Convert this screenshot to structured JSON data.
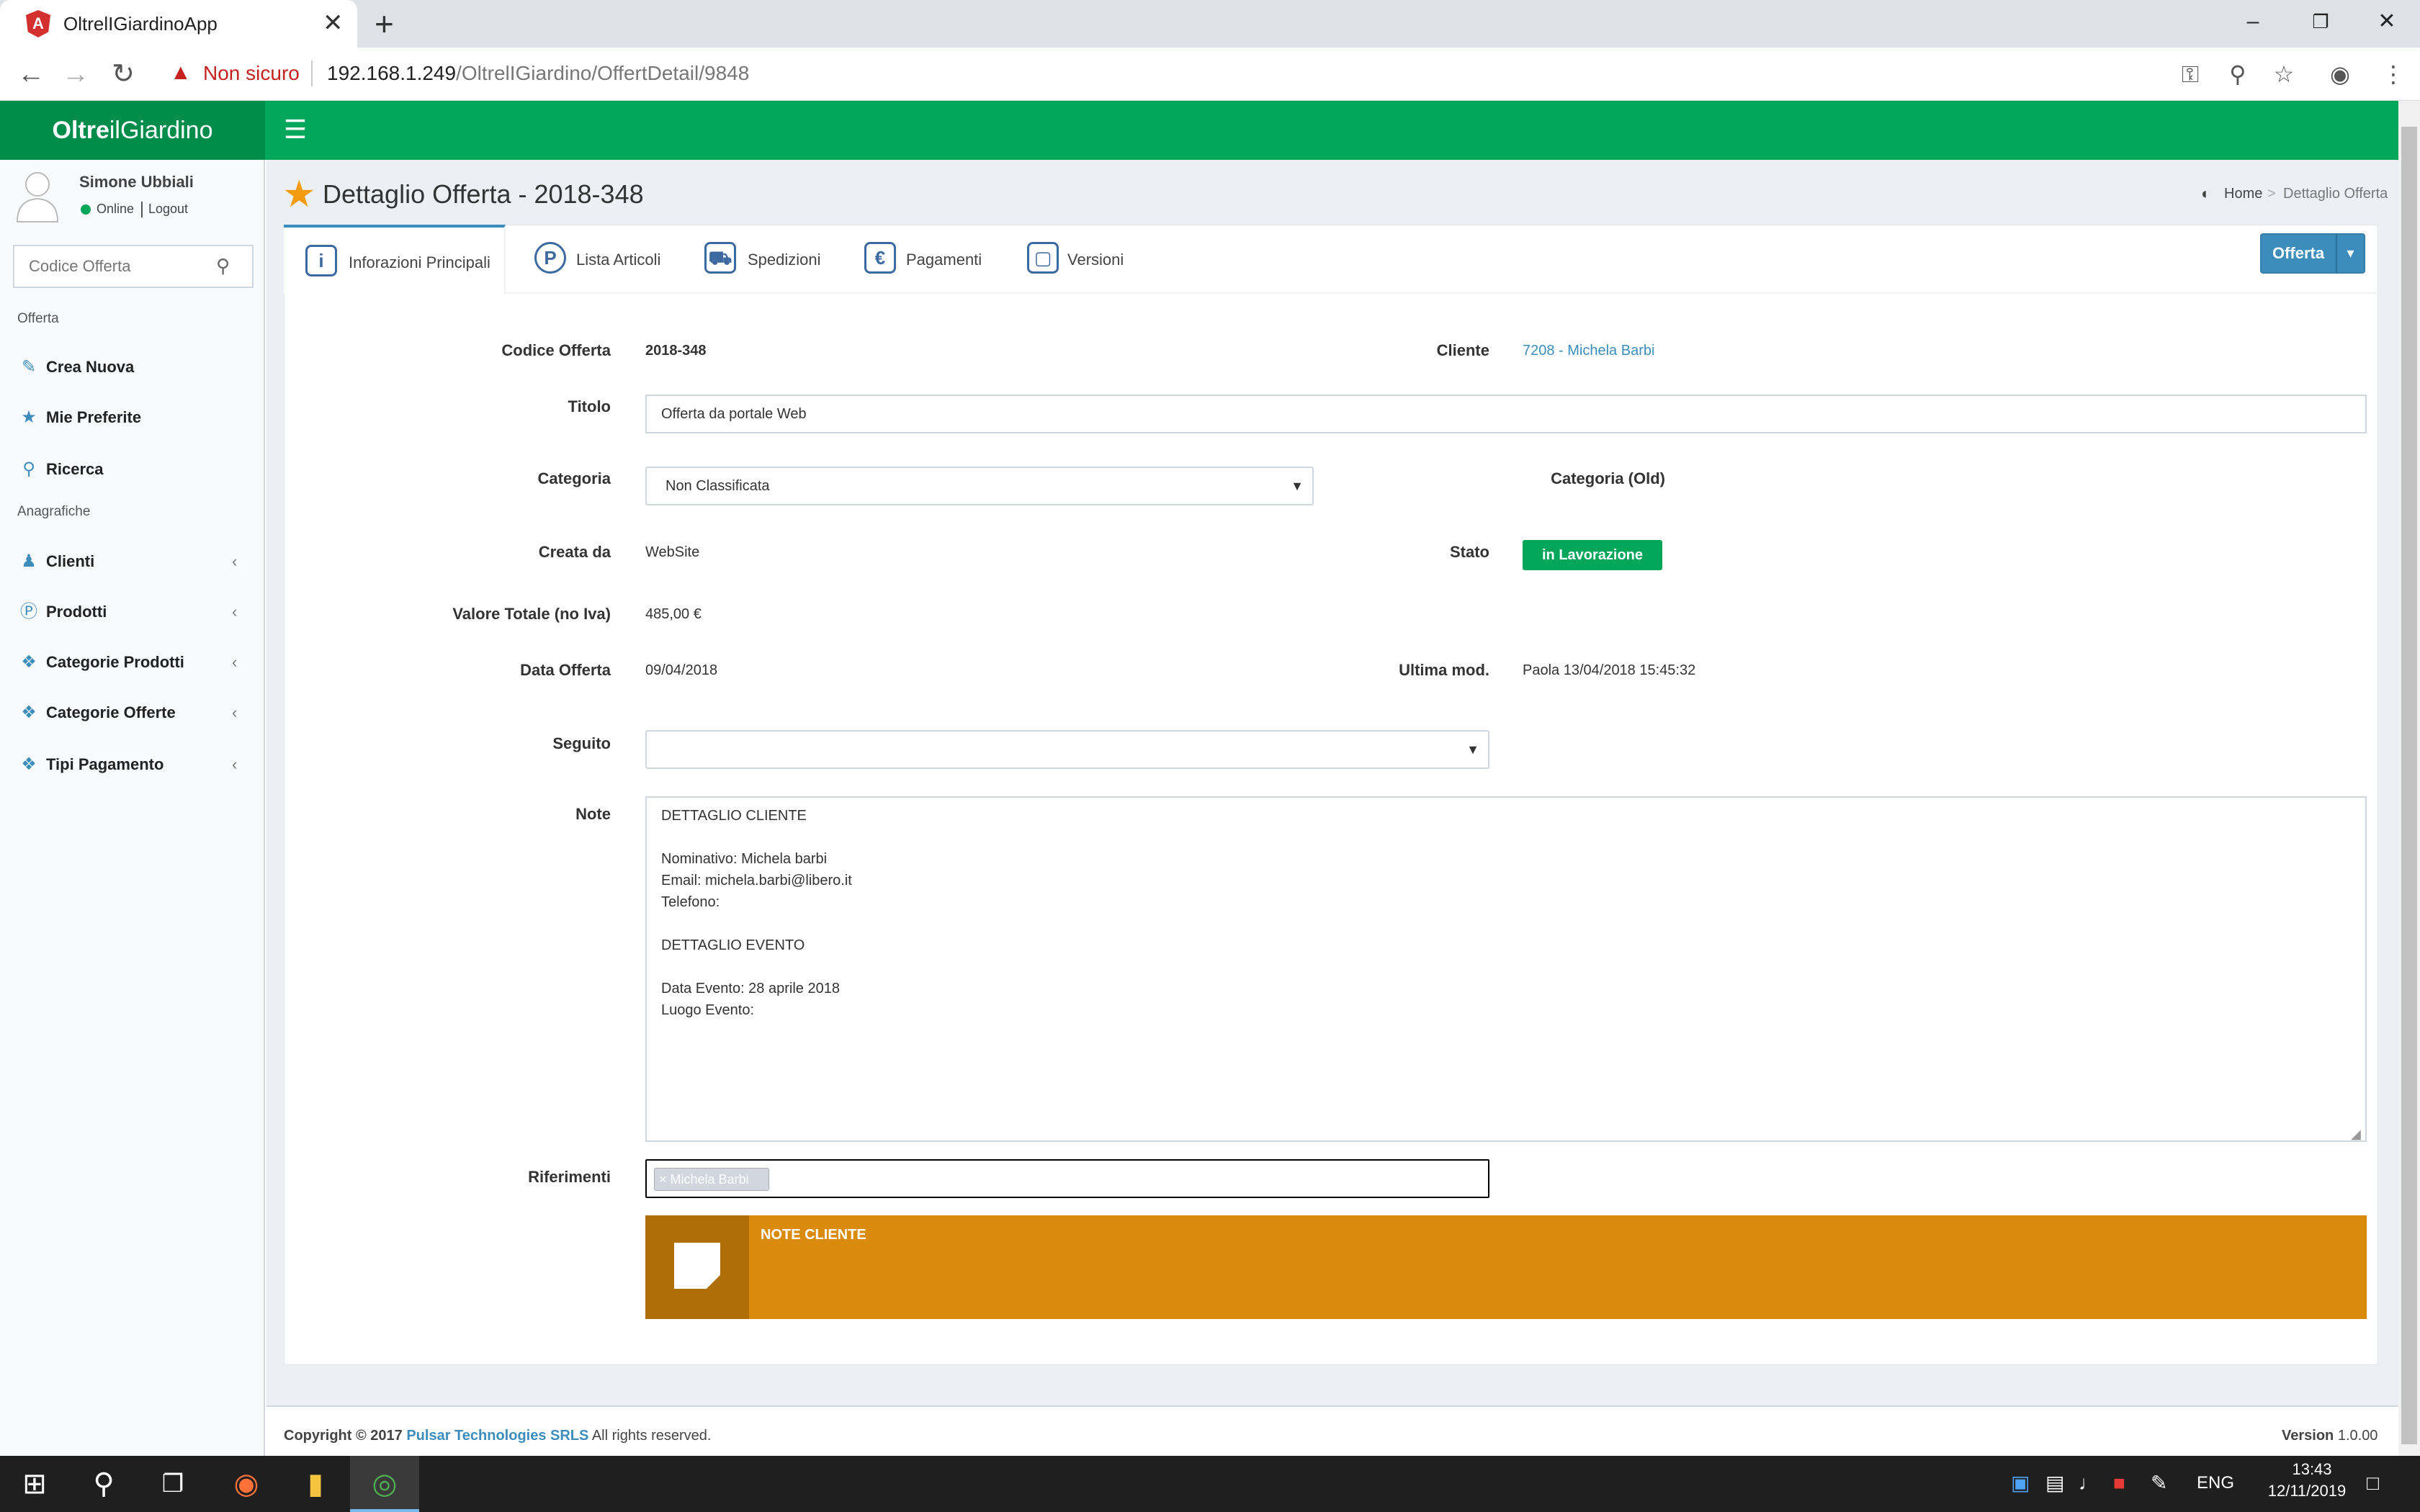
{
  "browser": {
    "tab_title": "OltrelIGiardinoApp",
    "tab_close": "✕",
    "new_tab": "+",
    "security_label": "Non sicuro",
    "url_host": "192.168.1.249",
    "url_path": "/OltrelIGiardino/OffertDetail/9848"
  },
  "app": {
    "logo_bold": "Oltre",
    "logo_rest": "ilGiardino"
  },
  "sidebar": {
    "user_name": "Simone Ubbiali",
    "user_status": "Online",
    "logout": "Logout",
    "search_placeholder": "Codice Offerta",
    "section_offerta": "Offerta",
    "section_anagrafiche": "Anagrafiche",
    "items": [
      {
        "label": "Crea Nuova",
        "icon": "pencil-icon"
      },
      {
        "label": "Mie Preferite",
        "icon": "star-icon"
      },
      {
        "label": "Ricerca",
        "icon": "search-icon"
      },
      {
        "label": "Clienti",
        "icon": "users-icon"
      },
      {
        "label": "Prodotti",
        "icon": "p-circle-icon"
      },
      {
        "label": "Categorie Prodotti",
        "icon": "tags-icon"
      },
      {
        "label": "Categorie Offerte",
        "icon": "tags-icon"
      },
      {
        "label": "Tipi Pagamento",
        "icon": "tags-icon"
      }
    ]
  },
  "page": {
    "title": "Dettaglio Offerta - 2018-348",
    "breadcrumb_home": "Home",
    "breadcrumb_current": "Dettaglio Offerta"
  },
  "tabs": [
    {
      "label": "Inforazioni Principali",
      "icon_glyph": "i"
    },
    {
      "label": "Lista Articoli",
      "icon_glyph": "P"
    },
    {
      "label": "Spedizioni",
      "icon_glyph": "⛟"
    },
    {
      "label": "Pagamenti",
      "icon_glyph": "€"
    },
    {
      "label": "Versioni",
      "icon_glyph": "▢"
    }
  ],
  "action_button": "Offerta",
  "form": {
    "codice_label": "Codice Offerta",
    "codice_value": "2018-348",
    "cliente_label": "Cliente",
    "cliente_value": "7208 - Michela Barbi",
    "titolo_label": "Titolo",
    "titolo_value": "Offerta da portale Web",
    "categoria_label": "Categoria",
    "categoria_value": "Non Classificata",
    "categoria_old_label": "Categoria (Old)",
    "creata_label": "Creata da",
    "creata_value": "WebSite",
    "stato_label": "Stato",
    "stato_value": "in Lavorazione",
    "valore_label": "Valore Totale (no Iva)",
    "valore_value": "485,00 €",
    "data_label": "Data Offerta",
    "data_value": "09/04/2018",
    "ultima_label": "Ultima mod.",
    "ultima_value": "Paola 13/04/2018 15:45:32",
    "seguito_label": "Seguito",
    "seguito_value": "",
    "note_label": "Note",
    "note_lines": [
      "DETTAGLIO CLIENTE",
      "",
      "Nominativo: Michela barbi",
      "Email: michela.barbi@libero.it",
      "Telefono:",
      "",
      "DETTAGLIO EVENTO",
      "",
      "Data Evento: 28 aprile 2018",
      "Luogo Evento:"
    ],
    "riferimenti_label": "Riferimenti",
    "riferimenti_chip": "Michela Barbi",
    "note_cliente_label": "NOTE CLIENTE"
  },
  "footer": {
    "copyright_prefix": "Copyright © 2017",
    "company": "Pulsar Technologies SRLS",
    "rights": "All rights reserved.",
    "version_label": "Version",
    "version_value": "1.0.00"
  },
  "taskbar": {
    "lang": "ENG",
    "time": "13:43",
    "date": "12/11/2019"
  },
  "colors": {
    "header_green": "#00a65a",
    "logo_green": "#008d4c",
    "primary_blue": "#3c8dbc",
    "note_orange": "#db8b0b",
    "star_orange": "#f39c12"
  }
}
